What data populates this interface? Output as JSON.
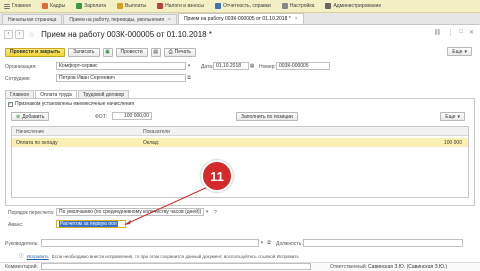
{
  "menu": [
    {
      "label": "Главное"
    },
    {
      "label": "Кадры"
    },
    {
      "label": "Зарплата"
    },
    {
      "label": "Выплаты"
    },
    {
      "label": "Налоги и взносы"
    },
    {
      "label": "Отчетность, справки"
    },
    {
      "label": "Настройка"
    },
    {
      "label": "Администрирование"
    }
  ],
  "tabs": [
    {
      "label": "Начальная страница"
    },
    {
      "label": "Прием на работу, переводы, увольнения"
    },
    {
      "label": "Прием на работу 003К-000005 от 01.10.2018 *"
    }
  ],
  "title": "Прием на работу 003К-000005 от 01.10.2018 *",
  "toolbar": {
    "post_close": "Провести и закрыть",
    "save": "Записать",
    "post": "Провести",
    "print": "Печать",
    "more": "Еще"
  },
  "form": {
    "org_label": "Организация:",
    "org_value": "Комфорт-сервис",
    "date_label": "Дата:",
    "date_value": "01.10.2018",
    "number_label": "Номер:",
    "number_value": "003К-000005",
    "employee_label": "Сотрудник:",
    "employee_value": "Петров Иван Сергеевич"
  },
  "subtabs": [
    {
      "label": "Главное"
    },
    {
      "label": "Оплата труда"
    },
    {
      "label": "Трудовой договор"
    }
  ],
  "pay": {
    "checkbox_label": "Признаком установлены ежемесячные начисления",
    "add": "Добавить",
    "fot_label": "ФОТ:",
    "fot_value": "100 000,00",
    "fill_btn": "Заполнить по позиции",
    "more": "Еще"
  },
  "grid": {
    "col_accrual": "Начисление",
    "col_indicators": "Показатели",
    "rows": [
      {
        "accrual": "Оплата по окладу",
        "indicator": "Оклад:",
        "value": "100 000"
      }
    ]
  },
  "recalc": {
    "label": "Порядок пересчета:",
    "value": "По умолчанию (по среднедневному количеству часов (дней))",
    "help": "?"
  },
  "advance": {
    "label": "Аванс:",
    "value": "Расчетом за первую пол"
  },
  "footer": {
    "head_label": "Руководитель:",
    "position_label": "Должность:",
    "fix_link": "Исправить",
    "help_text": "Если необходимо внести исправления, то при этом сохранится данный документ, воспользуйтесь ссылкой Исправить",
    "comment_label": "Комментарий:",
    "responsible_label": "Ответственный:",
    "responsible_value": "Савинская З.Ю. (Савинская З.Ю.)"
  },
  "annotation": {
    "number": "11",
    "color": "#d42a2a"
  }
}
